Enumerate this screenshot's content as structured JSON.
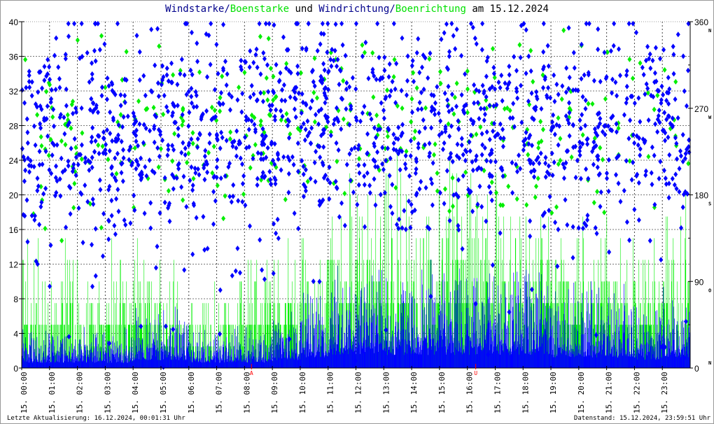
{
  "title": {
    "part1": "Windstarke",
    "slash1": "/",
    "part2": "Boenstarke",
    "part3": " und ",
    "part4": "Windrichtung",
    "slash2": "/",
    "part5": "Boenrichtung",
    "part6": " am 15.12.2024"
  },
  "footer": {
    "left": "Letzte Aktualisierung: 16.12.2024, 00:01:31 Uhr",
    "right": "Datenstand: 15.12.2024, 23:59:51 Uhr"
  },
  "colors": {
    "wind": "#0000ff",
    "gust": "#00ee00",
    "axis": "#000000",
    "grid": "#888888",
    "marker": "#ff0000"
  },
  "chart_data": {
    "type": "bar+scatter",
    "title": "Windstarke/Boenstarke und Windrichtung/Boenrichtung am 15.12.2024",
    "x_tick_labels": [
      "15.  00:00",
      "15.  01:00",
      "15.  02:00",
      "15.  03:00",
      "15.  04:00",
      "15.  05:00",
      "15.  06:00",
      "15.  07:00",
      "15.  08:00",
      "15.  09:00",
      "15.  10:00",
      "15.  11:00",
      "15.  12:00",
      "15.  13:00",
      "15.  14:00",
      "15.  15:00",
      "15.  16:00",
      "15.  17:00",
      "15.  18:00",
      "15.  19:00",
      "15.  20:00",
      "15.  21:00",
      "15.  22:00",
      "15.  23:00"
    ],
    "xlim_hours": [
      0,
      24
    ],
    "y_left": {
      "ylim": [
        0,
        40
      ],
      "ticks": [
        "0",
        "4",
        "8",
        "12",
        "16",
        "20",
        "24",
        "28",
        "32",
        "36",
        "40"
      ]
    },
    "y_right": {
      "ylim": [
        0,
        360
      ],
      "ticks": [
        "0",
        "90",
        "180",
        "270",
        "360"
      ],
      "compass": [
        "N",
        "O",
        "S",
        "W",
        "N"
      ]
    },
    "markers": [
      {
        "label": "A",
        "hour": 8.25
      },
      {
        "label": "U",
        "hour": 16.3
      }
    ],
    "series": [
      {
        "name": "Windstarke",
        "hourly_mean": [
          2,
          2,
          2,
          2,
          3,
          3,
          2,
          2,
          2,
          3,
          4,
          5,
          5,
          5,
          5,
          5,
          5,
          5,
          5,
          4,
          4,
          4,
          3,
          4
        ]
      },
      {
        "name": "Boenstarke",
        "hourly_max": [
          15,
          16,
          12,
          15,
          15,
          12,
          10,
          12,
          15,
          15,
          20,
          24,
          25,
          25,
          22,
          28,
          24,
          26,
          22,
          20,
          20,
          18,
          16,
          22
        ]
      },
      {
        "name": "Windrichtung",
        "hourly_mean_deg": [
          245,
          240,
          250,
          240,
          245,
          255,
          245,
          240,
          250,
          250,
          255,
          260,
          255,
          250,
          245,
          250,
          245,
          250,
          250,
          245,
          250,
          255,
          250,
          250
        ]
      },
      {
        "name": "Boenrichtung",
        "hourly_mean_deg": [
          240,
          245,
          245,
          240,
          240,
          250,
          245,
          240,
          245,
          250,
          250,
          255,
          255,
          245,
          245,
          250,
          245,
          250,
          245,
          245,
          250,
          255,
          245,
          245
        ]
      }
    ]
  }
}
